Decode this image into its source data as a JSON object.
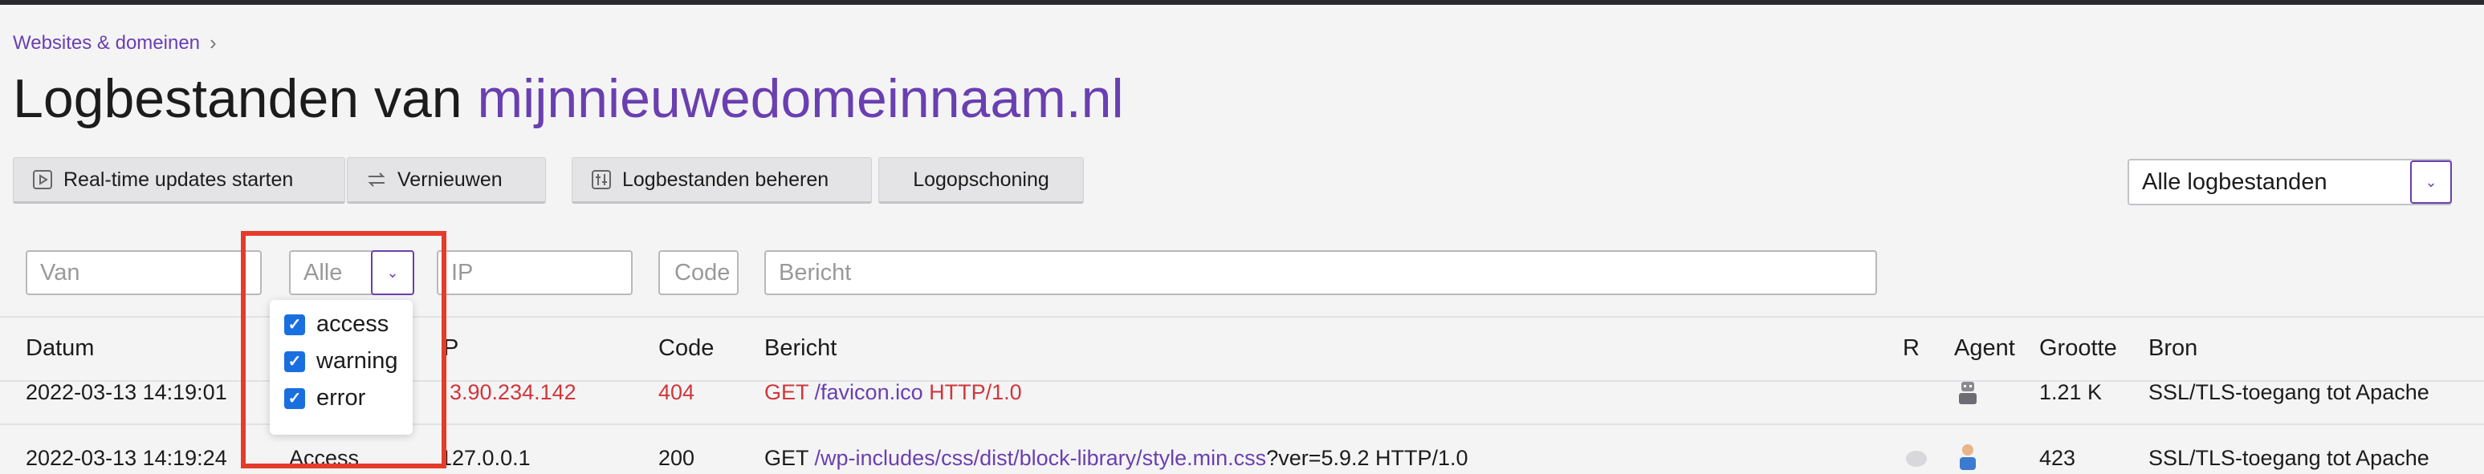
{
  "breadcrumb": {
    "label": "Websites & domeinen"
  },
  "title": {
    "prefix": "Logbestanden van ",
    "domain": "mijnnieuwedomeinnaam.nl"
  },
  "toolbar": {
    "realtime": "Real-time updates starten",
    "refresh": "Vernieuwen",
    "manage": "Logbestanden beheren",
    "cleanup": "Logopschoning"
  },
  "logselect": {
    "value": "Alle logbestanden"
  },
  "filters": {
    "van_placeholder": "Van",
    "type_placeholder": "Alle",
    "ip_placeholder": "IP",
    "code_placeholder": "Code",
    "bericht_placeholder": "Bericht"
  },
  "type_options": [
    {
      "label": "access",
      "checked": true
    },
    {
      "label": "warning",
      "checked": true
    },
    {
      "label": "error",
      "checked": true
    }
  ],
  "columns": {
    "datum": "Datum",
    "ip": "P",
    "code": "Code",
    "bericht": "Bericht",
    "r": "R",
    "agent": "Agent",
    "grootte": "Grootte",
    "bron": "Bron"
  },
  "rows": [
    {
      "datum": "2022-03-13 14:19:01",
      "ip": "3.90.234.142",
      "code": "404",
      "bericht_pre": "GET ",
      "bericht_link": "/favicon.ico",
      "bericht_post": " HTTP/1.0",
      "grootte": "1.21 K",
      "bron": "SSL/TLS-toegang tot Apache"
    },
    {
      "datum": "2022-03-13 14:19:24",
      "type": "Access",
      "ip": "127.0.0.1",
      "code": "200",
      "bericht_pre": "GET ",
      "bericht_link": "/wp-includes/css/dist/block-library/style.min.css",
      "bericht_post": "?ver=5.9.2 HTTP/1.0",
      "grootte": "423",
      "bron": "SSL/TLS-toegang tot Apache"
    }
  ],
  "colors": {
    "accent": "#6a3fb0",
    "error": "#d0363a",
    "highlight": "#e63b2a",
    "checkbox": "#1a6fe0"
  }
}
